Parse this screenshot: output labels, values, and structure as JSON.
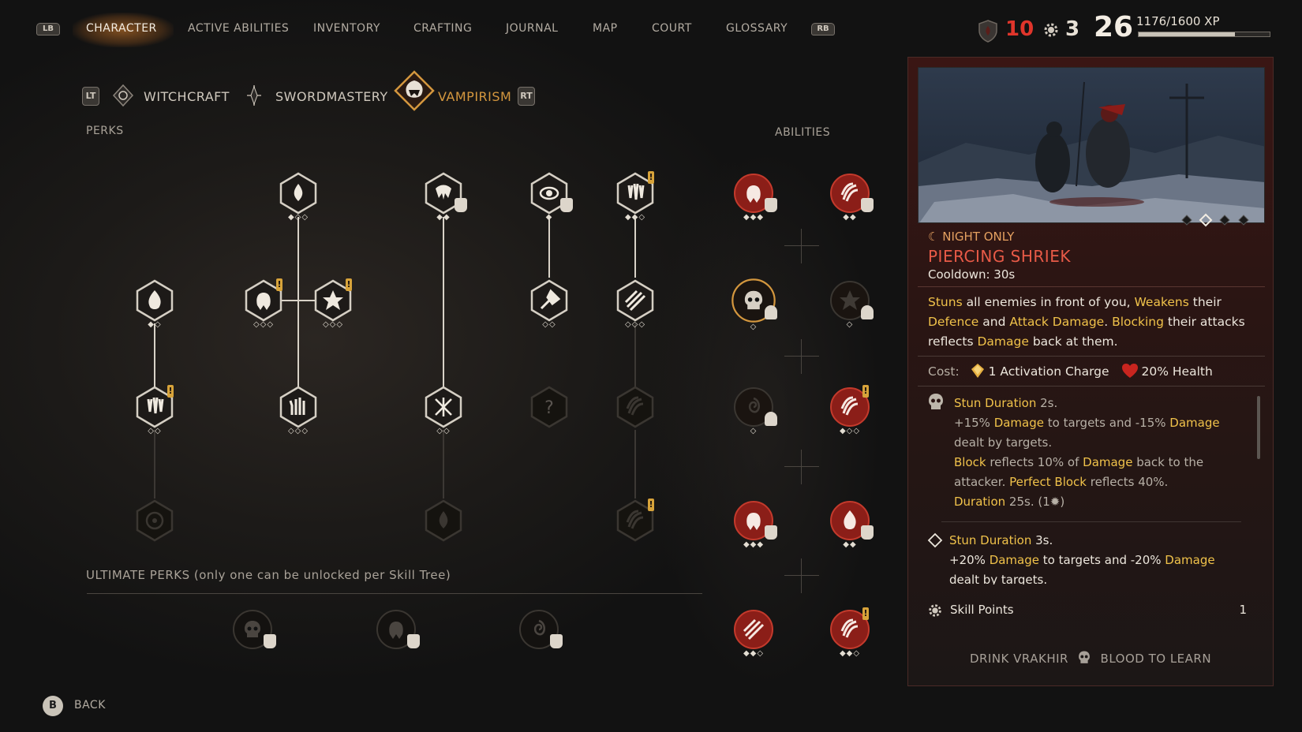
{
  "nav": {
    "left_bumper": "LB",
    "right_bumper": "RB",
    "tabs": [
      "CHARACTER",
      "ACTIVE ABILITIES",
      "INVENTORY",
      "CRAFTING",
      "JOURNAL",
      "MAP",
      "COURT",
      "GLOSSARY"
    ],
    "active_tab": "CHARACTER"
  },
  "stats": {
    "blood_value": "10",
    "skill_points_value": "3",
    "level": "26",
    "xp_text": "1176/1600 XP",
    "xp_progress": 0.735,
    "colors": {
      "blood": "#e0352b",
      "accent": "#d4973e",
      "title_red": "#e85a47",
      "highlight": "#f0c24a"
    }
  },
  "subtabs": {
    "left_trigger": "LT",
    "right_trigger": "RT",
    "items": [
      "WITCHCRAFT",
      "SWORDMASTERY",
      "VAMPIRISM"
    ],
    "active": "VAMPIRISM"
  },
  "sections": {
    "perks": "PERKS",
    "abilities": "ABILITIES",
    "ultimate": "ULTIMATE PERKS (only one can be unlocked per Skill Tree)"
  },
  "perk_nodes": [
    {
      "icon": "blood-drop-icon",
      "pips": "◆◇◇"
    },
    {
      "icon": "fanged-mouth-icon",
      "pips": "◆◆"
    },
    {
      "icon": "eye-icon",
      "pips": "◆"
    },
    {
      "icon": "dripping-claw-icon",
      "pips": "◆◆◇"
    },
    {
      "icon": "flame-hand-icon",
      "pips": "◆◇"
    },
    {
      "icon": "bat-face-icon",
      "pips": "◇◇◇"
    },
    {
      "icon": "spiked-star-icon",
      "pips": "◇◇◇"
    },
    {
      "icon": "axe-strike-icon",
      "pips": "◇◇"
    },
    {
      "icon": "slash-marks-icon",
      "pips": "◇◇◇"
    },
    {
      "icon": "blood-drops-icon",
      "pips": "◇◇"
    },
    {
      "icon": "bloody-hand-icon",
      "pips": "◇◇◇"
    },
    {
      "icon": "crossed-slash-icon",
      "pips": "◇◇"
    },
    {
      "icon": "locked-question-icon",
      "pips": ""
    },
    {
      "icon": "claw-icon",
      "pips": ""
    },
    {
      "icon": "rune-circle-icon",
      "pips": ""
    },
    {
      "icon": "blood-fountain-icon",
      "pips": ""
    },
    {
      "icon": "grasping-claw-icon",
      "pips": ""
    }
  ],
  "ability_nodes": [
    {
      "icon": "shriek-face-icon",
      "pips": "◆◆◆"
    },
    {
      "icon": "bird-swoop-icon",
      "pips": "◆◆"
    },
    {
      "icon": "beast-head-icon",
      "pips": "◇"
    },
    {
      "icon": "dark-burst-icon",
      "pips": "◇"
    },
    {
      "icon": "vortex-icon",
      "pips": "◇"
    },
    {
      "icon": "leaping-beast-icon",
      "pips": "◆◇◇"
    },
    {
      "icon": "horned-mask-icon",
      "pips": "◆◆◆"
    },
    {
      "icon": "heart-rune-icon",
      "pips": "◆◆"
    },
    {
      "icon": "blood-slash-icon",
      "pips": "◆◆◇"
    },
    {
      "icon": "wing-strike-icon",
      "pips": "◆◆◇"
    }
  ],
  "ultimate_nodes": [
    {
      "icon": "skull-icon"
    },
    {
      "icon": "bat-sigil-icon"
    },
    {
      "icon": "spiral-sigil-icon"
    }
  ],
  "panel": {
    "night_only": "NIGHT ONLY",
    "title": "PIERCING SHRIEK",
    "cooldown": "Cooldown: 30s",
    "desc": {
      "stuns": "Stuns",
      "t1": " all enemies in front of you, ",
      "weakens": "Weakens",
      "t2": " their ",
      "defence": "Defence",
      "t3": " and ",
      "attack": "Attack Damage",
      "t4": ". ",
      "blocking": "Blocking",
      "t5": " their attacks reflects ",
      "damage": "Damage",
      "t6": " back at them."
    },
    "cost_label": "Cost:",
    "cost_charge": "1 Activation Charge",
    "cost_health": "20% Health",
    "upgrade1": {
      "stun": "Stun Duration",
      "stun_val": " 2s.",
      "l2a": "+15% ",
      "dmg": "Damage",
      "l2b": " to targets and -15% ",
      "l2c": "dealt by targets.",
      "block": "Block",
      "l3a": " reflects 10% of ",
      "l3b": " back to the",
      "l4a": "attacker. ",
      "perfect": "Perfect Block",
      "l4b": " reflects 40%.",
      "duration": "Duration",
      "dur_val": " 25s. (1",
      "dur_end": ")"
    },
    "upgrade2": {
      "stun": "Stun Duration",
      "stun_val": " 3s.",
      "l2a": "+20% ",
      "dmg": "Damage",
      "l2b": " to targets and -20% ",
      "l2c": "dealt by targets."
    },
    "skill_points_label": "Skill Points",
    "skill_points_value": "1",
    "drink_a": "DRINK VRAKHIR",
    "drink_b": "BLOOD TO LEARN"
  },
  "footer": {
    "back_button": "B",
    "back_label": "BACK"
  }
}
